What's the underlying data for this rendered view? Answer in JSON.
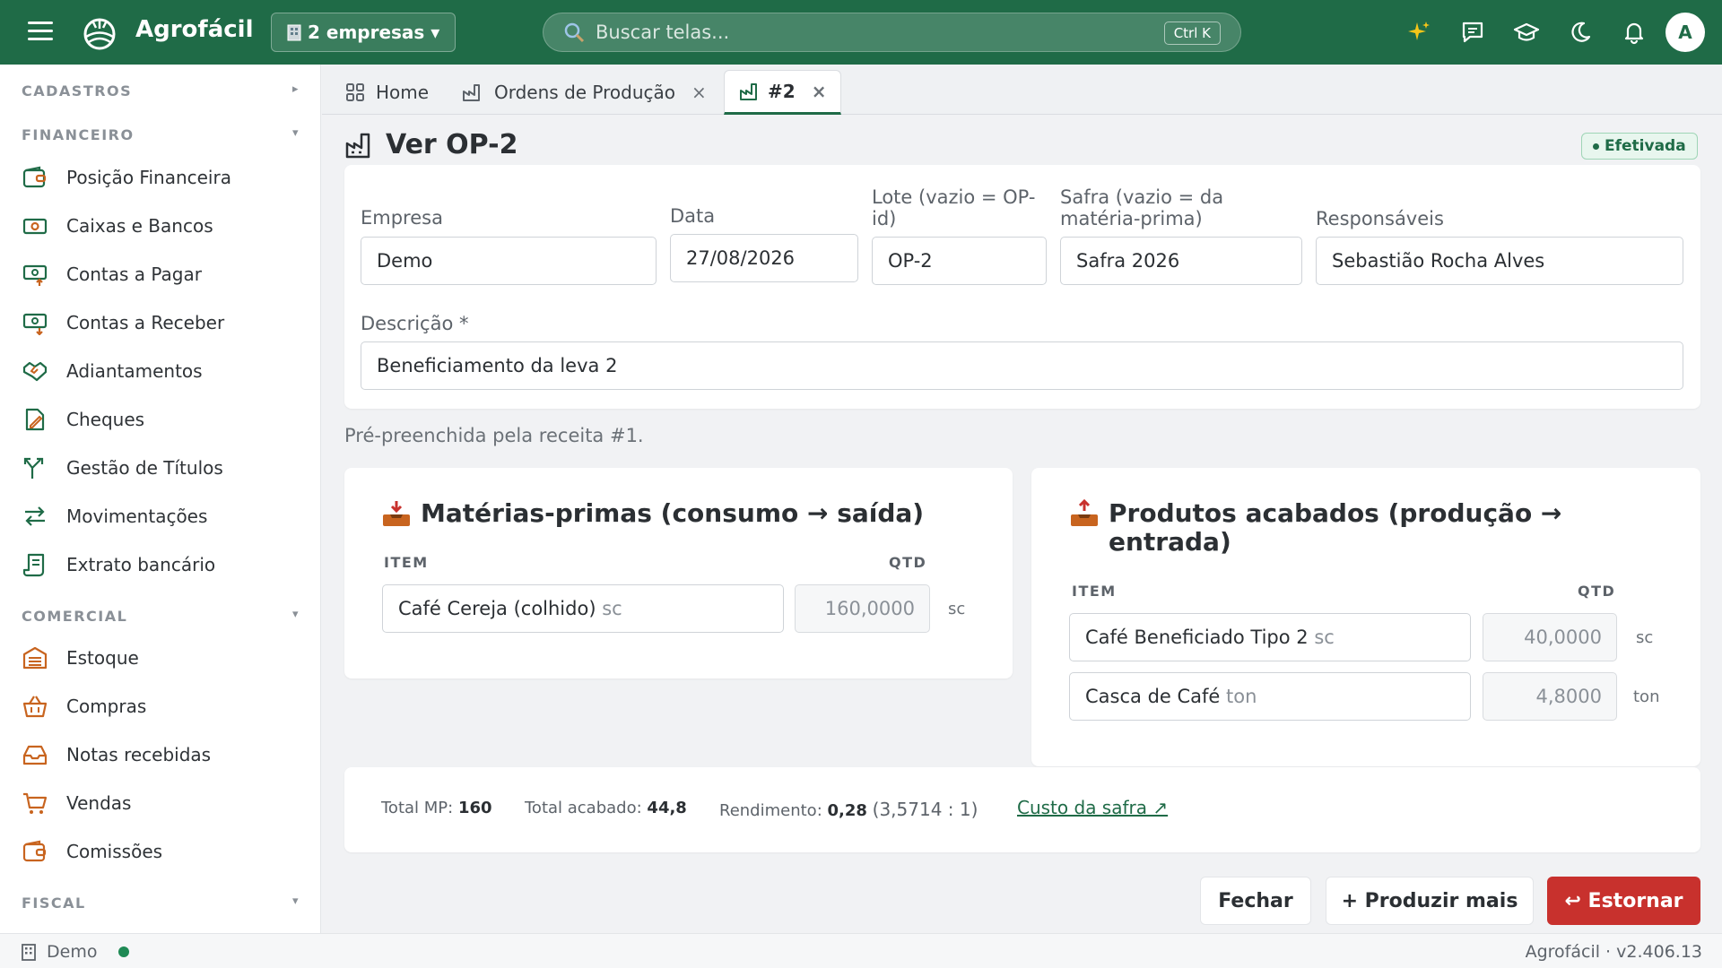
{
  "app": {
    "brand": "Agrofácil",
    "user_initial": "A"
  },
  "header": {
    "company_selector": "2 empresas ▾",
    "search": {
      "placeholder": "Buscar telas...",
      "shortcut": "Ctrl K"
    }
  },
  "sidebar": {
    "sections": [
      {
        "title": "CADASTROS",
        "caret": "▸"
      },
      {
        "title": "FINANCEIRO",
        "caret": "▾"
      },
      {
        "title": "COMERCIAL",
        "caret": "▾"
      },
      {
        "title": "FISCAL",
        "caret": "▾"
      }
    ],
    "financeiro": [
      {
        "label": "Posição Financeira",
        "icon": "wallet-icon"
      },
      {
        "label": "Caixas e Bancos",
        "icon": "cash-icon"
      },
      {
        "label": "Contas a Pagar",
        "icon": "cash-out-icon"
      },
      {
        "label": "Contas a Receber",
        "icon": "cash-in-icon"
      },
      {
        "label": "Adiantamentos",
        "icon": "handshake-icon"
      },
      {
        "label": "Cheques",
        "icon": "cheque-icon"
      },
      {
        "label": "Gestão de Títulos",
        "icon": "branch-icon"
      },
      {
        "label": "Movimentações",
        "icon": "arrows-icon"
      },
      {
        "label": "Extrato bancário",
        "icon": "statement-icon"
      }
    ],
    "comercial": [
      {
        "label": "Estoque",
        "icon": "warehouse-icon"
      },
      {
        "label": "Compras",
        "icon": "basket-icon"
      },
      {
        "label": "Notas recebidas",
        "icon": "inbox-icon"
      },
      {
        "label": "Vendas",
        "icon": "cart-icon"
      },
      {
        "label": "Comissões",
        "icon": "wallet-icon"
      }
    ]
  },
  "tabs": [
    {
      "label": "Home"
    },
    {
      "label": "Ordens de Produção",
      "close": "×"
    },
    {
      "label": "#2",
      "close": "×"
    }
  ],
  "page": {
    "title": "Ver OP-2",
    "status": "Efetivada",
    "fields": {
      "empresa": {
        "label": "Empresa",
        "value": "Demo"
      },
      "data": {
        "label": "Data",
        "value": "27/08/2026"
      },
      "lote": {
        "label": "Lote (vazio = OP-id)",
        "value": "OP-2"
      },
      "safra": {
        "label": "Safra (vazio = da matéria-prima)",
        "value": "Safra 2026"
      },
      "responsaveis": {
        "label": "Responsáveis",
        "value": "Sebastião Rocha Alves"
      },
      "descricao": {
        "label": "Descrição *",
        "value": "Beneficiamento da leva 2"
      }
    },
    "hint": "Pré-preenchida pela receita #1."
  },
  "materias_primas": {
    "title": "Matérias-primas (consumo → saída)",
    "col_item": "ITEM",
    "col_qty": "QTD",
    "rows": [
      {
        "item": "Café Cereja (colhido)",
        "item_unit": "sc",
        "qty": "160,0000",
        "unit": "sc"
      }
    ]
  },
  "produtos_acabados": {
    "title": "Produtos acabados (produção → entrada)",
    "col_item": "ITEM",
    "col_qty": "QTD",
    "rows": [
      {
        "item": "Café Beneficiado Tipo 2",
        "item_unit": "sc",
        "qty": "40,0000",
        "unit": "sc"
      },
      {
        "item": "Casca de Café",
        "item_unit": "ton",
        "qty": "4,8000",
        "unit": "ton"
      }
    ]
  },
  "totals": {
    "mp_label": "Total MP:",
    "mp_value": "160",
    "acabado_label": "Total acabado:",
    "acabado_value": "44,8",
    "rendimento_label": "Rendimento:",
    "rendimento_value": "0,28",
    "rendimento_ratio": "(3,5714 : 1)",
    "custo_link": "Custo da safra ↗"
  },
  "actions": {
    "close": "Fechar",
    "produce_more": "+ Produzir mais",
    "reverse": "↩ Estornar"
  },
  "footer": {
    "company": "Demo",
    "version": "Agrofácil · v2.406.13"
  },
  "colors": {
    "brand": "#1f6b47",
    "danger": "#c8312d",
    "success": "#1f8a55",
    "icon_finance": "#1f6b47",
    "icon_commerce": "#c8641f"
  }
}
